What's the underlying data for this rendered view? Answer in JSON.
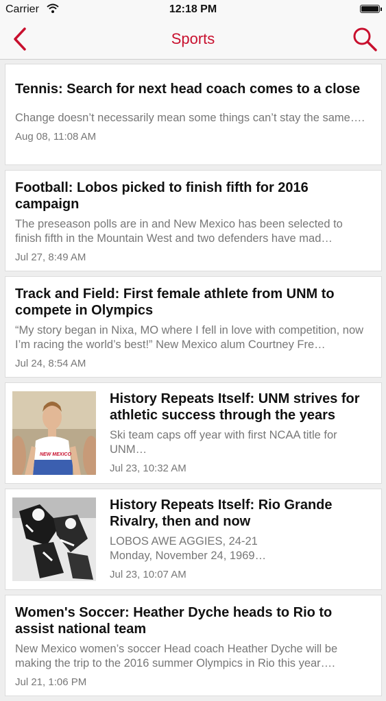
{
  "status_bar": {
    "carrier": "Carrier",
    "time": "12:18 PM"
  },
  "nav": {
    "title": "Sports"
  },
  "articles": [
    {
      "headline": "Tennis: Search for next head coach comes to a close",
      "summary": "Change doesn’t necessarily mean some things can’t stay the same….",
      "date": "Aug 08, 11:08 AM"
    },
    {
      "headline": "Football: Lobos picked to finish fifth for 2016 campaign",
      "summary": "The preseason polls are in and New Mexico has been selected to finish fifth in the Mountain West and two defenders have mad…",
      "date": "Jul 27, 8:49 AM"
    },
    {
      "headline": "Track and Field: First female athlete from UNM to compete in Olympics",
      "summary": "“My story began in Nixa, MO where I fell in love with competition, now I’m racing the world’s best!” New Mexico alum Courtney Fre…",
      "date": "Jul 24, 8:54 AM"
    },
    {
      "headline": "History Repeats Itself:  UNM strives for athletic success through the years",
      "summary": "Ski team caps off year with first NCAA title for UNM…",
      "date": "Jul 23, 10:32 AM",
      "thumb_text": "NEW MEXICO"
    },
    {
      "headline": "History Repeats Itself:  Rio Grande Rivalry, then and now",
      "summary": "LOBOS AWE AGGIES, 24-21 Monday, November 24, 1969…",
      "date": "Jul 23, 10:07 AM"
    },
    {
      "headline": "Women's Soccer: Heather Dyche heads to Rio to assist national team",
      "summary": "New Mexico women’s soccer Head coach Heather Dyche will be making the trip to the 2016 summer Olympics in Rio this year….",
      "date": "Jul 21, 1:06 PM"
    }
  ],
  "colors": {
    "accent": "#c8102e",
    "background": "#eeeeee"
  }
}
